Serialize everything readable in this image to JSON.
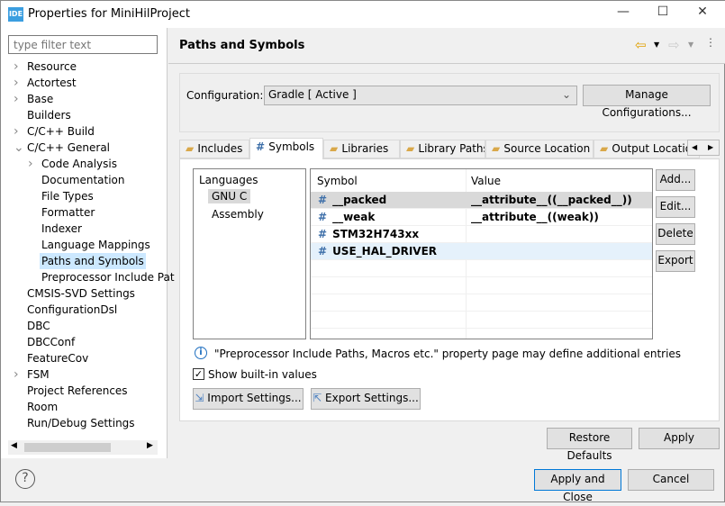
{
  "window": {
    "app_icon": "IDE",
    "title": "Properties for MiniHilProject",
    "minimize": "—",
    "maximize": "☐",
    "close": "✕"
  },
  "sidebar": {
    "filter_placeholder": "type filter text",
    "items": [
      {
        "label": "Resource",
        "level": 0,
        "expander": "collapsed"
      },
      {
        "label": "Actortest",
        "level": 0,
        "expander": "collapsed"
      },
      {
        "label": "Base",
        "level": 0,
        "expander": "collapsed"
      },
      {
        "label": "Builders",
        "level": 0,
        "expander": "none"
      },
      {
        "label": "C/C++ Build",
        "level": 0,
        "expander": "collapsed"
      },
      {
        "label": "C/C++ General",
        "level": 0,
        "expander": "expanded"
      },
      {
        "label": "Code Analysis",
        "level": 1,
        "expander": "collapsed"
      },
      {
        "label": "Documentation",
        "level": 1,
        "expander": "none"
      },
      {
        "label": "File Types",
        "level": 1,
        "expander": "none"
      },
      {
        "label": "Formatter",
        "level": 1,
        "expander": "none"
      },
      {
        "label": "Indexer",
        "level": 1,
        "expander": "none"
      },
      {
        "label": "Language Mappings",
        "level": 1,
        "expander": "none"
      },
      {
        "label": "Paths and Symbols",
        "level": 1,
        "expander": "none",
        "selected": true
      },
      {
        "label": "Preprocessor Include Pat",
        "level": 1,
        "expander": "none"
      },
      {
        "label": "CMSIS-SVD Settings",
        "level": 0,
        "expander": "none"
      },
      {
        "label": "ConfigurationDsl",
        "level": 0,
        "expander": "none"
      },
      {
        "label": "DBC",
        "level": 0,
        "expander": "none"
      },
      {
        "label": "DBCConf",
        "level": 0,
        "expander": "none"
      },
      {
        "label": "FeatureCov",
        "level": 0,
        "expander": "none"
      },
      {
        "label": "FSM",
        "level": 0,
        "expander": "collapsed"
      },
      {
        "label": "Project References",
        "level": 0,
        "expander": "none"
      },
      {
        "label": "Room",
        "level": 0,
        "expander": "none"
      },
      {
        "label": "Run/Debug Settings",
        "level": 0,
        "expander": "none"
      }
    ]
  },
  "main": {
    "title": "Paths and Symbols",
    "configuration_label": "Configuration:",
    "configuration_value": "Gradle  [ Active ]",
    "manage_button": "Manage Configurations...",
    "tabs": [
      {
        "label": "Includes",
        "icon": "folder-icon"
      },
      {
        "label": "Symbols",
        "icon": "#",
        "active": true
      },
      {
        "label": "Libraries",
        "icon": "books-icon"
      },
      {
        "label": "Library Paths",
        "icon": "folder-icon"
      },
      {
        "label": "Source Location",
        "icon": "folder-icon"
      },
      {
        "label": "Output Locatio",
        "icon": "folder-icon"
      }
    ],
    "languages": {
      "header": "Languages",
      "items": [
        "GNU C",
        "Assembly"
      ]
    },
    "table": {
      "headers": [
        "Symbol",
        "Value"
      ],
      "rows": [
        {
          "symbol": "__packed",
          "value": "__attribute__((__packed__))"
        },
        {
          "symbol": "__weak",
          "value": "__attribute__((weak))"
        },
        {
          "symbol": "STM32H743xx",
          "value": ""
        },
        {
          "symbol": "USE_HAL_DRIVER",
          "value": ""
        }
      ]
    },
    "side_buttons": [
      "Add...",
      "Edit...",
      "Delete",
      "Export"
    ],
    "info": "\"Preprocessor Include Paths, Macros etc.\" property page may define additional entries",
    "show_builtin": "Show built-in values",
    "import_button": "Import Settings...",
    "export_button": "Export Settings...",
    "restore_defaults": "Restore Defaults",
    "apply": "Apply"
  },
  "footer": {
    "help": "?",
    "apply_close": "Apply and Close",
    "cancel": "Cancel"
  }
}
